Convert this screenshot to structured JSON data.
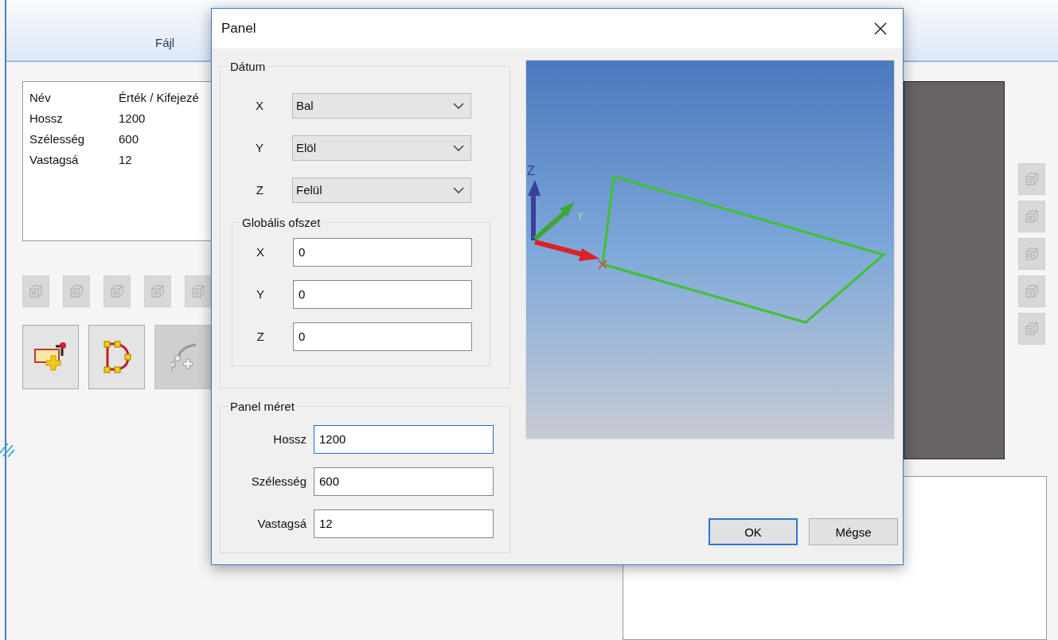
{
  "app": {
    "ribbon": {
      "tabs": [
        {
          "label": "Fájl"
        }
      ]
    },
    "properties_table": {
      "columns": [
        "Név",
        "Érték / Kifejezé"
      ],
      "rows": [
        [
          "Hossz",
          "1200"
        ],
        [
          "Szélesség",
          "600"
        ],
        [
          "Vastagsá",
          "12"
        ]
      ]
    },
    "view_buttons": [
      {
        "disabled": true
      },
      {
        "disabled": true
      },
      {
        "disabled": true
      },
      {
        "disabled": true
      },
      {
        "disabled": true
      }
    ],
    "tool_buttons": [
      {
        "kind": "add-panel",
        "disabled": false
      },
      {
        "kind": "edge",
        "disabled": false
      },
      {
        "kind": "curve",
        "disabled": true
      }
    ],
    "side_view_buttons": [
      {
        "disabled": true
      },
      {
        "disabled": true
      },
      {
        "disabled": true
      },
      {
        "disabled": true
      },
      {
        "disabled": true
      }
    ]
  },
  "dialog": {
    "title": "Panel",
    "datum": {
      "legend": "Dátum",
      "axes": [
        {
          "label": "X",
          "value": "Bal"
        },
        {
          "label": "Y",
          "value": "Elöl"
        },
        {
          "label": "Z",
          "value": "Felül"
        }
      ]
    },
    "global_offset": {
      "legend": "Globális ofszet",
      "fields": [
        {
          "label": "X",
          "value": "0"
        },
        {
          "label": "Y",
          "value": "0"
        },
        {
          "label": "Z",
          "value": "0"
        }
      ]
    },
    "panel_size": {
      "legend": "Panel méret",
      "fields": [
        {
          "label": "Hossz",
          "value": "1200",
          "focused": true
        },
        {
          "label": "Szélesség",
          "value": "600",
          "focused": false
        },
        {
          "label": "Vastagsá",
          "value": "12",
          "focused": false
        }
      ]
    },
    "preview": {
      "axis_labels": [
        "Z",
        "Y"
      ]
    },
    "buttons": [
      {
        "label": "OK",
        "default": true
      },
      {
        "label": "Mégse",
        "default": false
      }
    ]
  }
}
